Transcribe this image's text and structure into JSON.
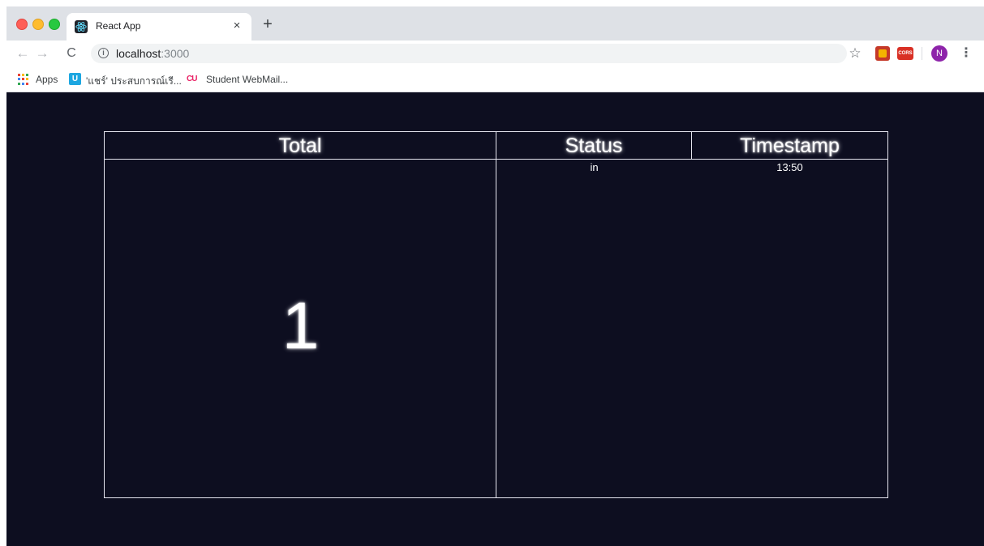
{
  "browser": {
    "tab": {
      "title": "React App",
      "close_glyph": "×"
    },
    "new_tab_glyph": "+",
    "url": {
      "host": "localhost",
      "port": ":3000"
    },
    "profile_initial": "N",
    "extension_cors_label": "CORS",
    "bookmarks": [
      {
        "label": "Apps",
        "icon": "apps-grid-icon"
      },
      {
        "label": "'แชร์' ประสบการณ์เรี...",
        "icon": "u-icon"
      },
      {
        "label": "Student WebMail...",
        "icon": "cu-icon"
      }
    ]
  },
  "table": {
    "headers": {
      "total": "Total",
      "status": "Status",
      "timestamp": "Timestamp"
    },
    "total_value": "1",
    "rows": [
      {
        "status": "in",
        "timestamp": "13:50"
      }
    ]
  },
  "colors": {
    "page_background": "#0d0e20",
    "table_border": "#e6e6f0",
    "text": "#ffffff"
  }
}
